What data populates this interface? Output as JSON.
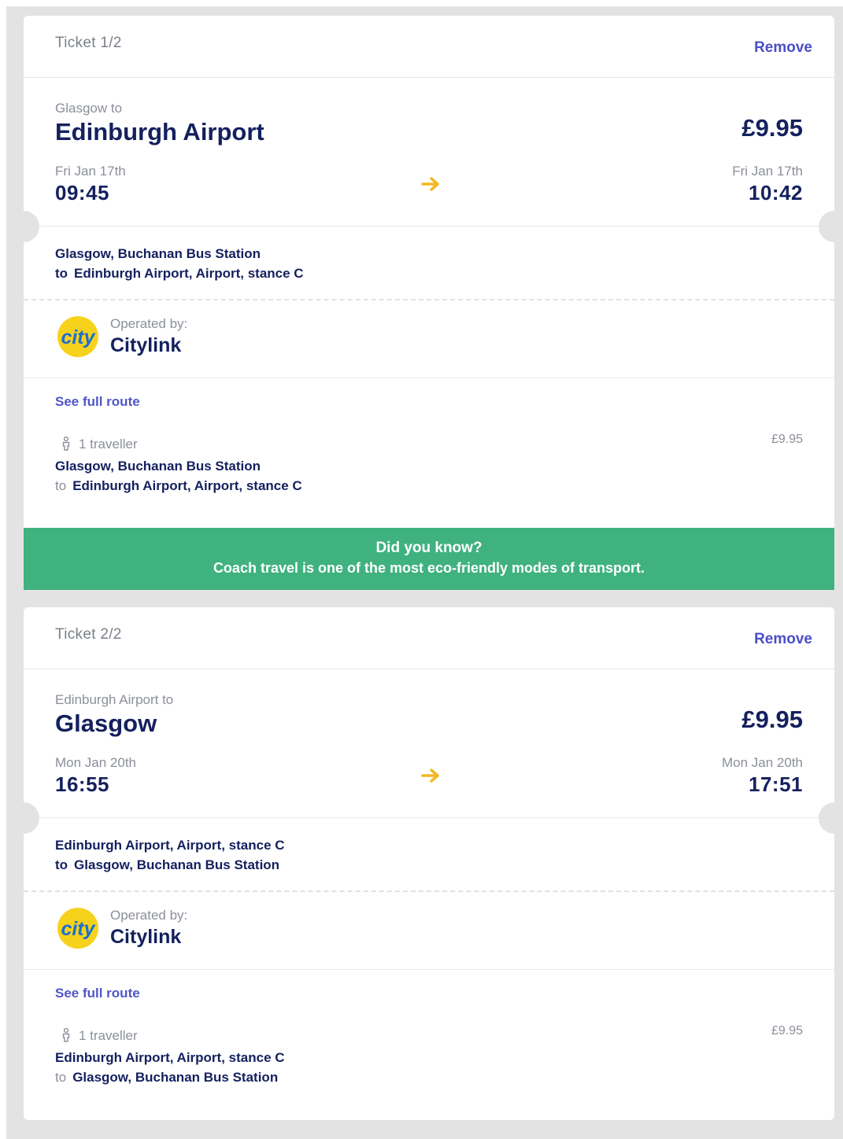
{
  "tickets": [
    {
      "label": "Ticket 1/2",
      "remove_label": "Remove",
      "from_line": "Glasgow to",
      "destination": "Edinburgh Airport",
      "price": "£9.95",
      "departure_date": "Fri Jan 17th",
      "departure_time": "09:45",
      "arrival_date": "Fri Jan 17th",
      "arrival_time": "10:42",
      "stop_from": "Glasgow, Buchanan Bus Station",
      "to_word": "to",
      "stop_to": "Edinburgh Airport, Airport, stance C",
      "operated_by_label": "Operated by:",
      "operator_name": "Citylink",
      "operator_logo_text": "city",
      "see_full_route": "See full route",
      "traveller_count": "1 traveller",
      "traveller_price": "£9.95"
    },
    {
      "label": "Ticket 2/2",
      "remove_label": "Remove",
      "from_line": "Edinburgh Airport to",
      "destination": "Glasgow",
      "price": "£9.95",
      "departure_date": "Mon Jan 20th",
      "departure_time": "16:55",
      "arrival_date": "Mon Jan 20th",
      "arrival_time": "17:51",
      "stop_from": "Edinburgh Airport, Airport, stance C",
      "to_word": "to",
      "stop_to": "Glasgow, Buchanan Bus Station",
      "operated_by_label": "Operated by:",
      "operator_name": "Citylink",
      "operator_logo_text": "city",
      "see_full_route": "See full route",
      "traveller_count": "1 traveller",
      "traveller_price": "£9.95"
    }
  ],
  "banner": {
    "title": "Did you know?",
    "text": "Coach travel is one of the most eco-friendly modes of transport."
  },
  "icons": {
    "arrow": "arrow-right-icon",
    "person": "person-icon",
    "logo": "citylink-logo"
  },
  "colors": {
    "brand_navy": "#14205e",
    "link_purple": "#4b4fc6",
    "banner_green": "#3fb27f",
    "arrow_yellow": "#f2b824",
    "background_grey": "#e3e3e3"
  }
}
